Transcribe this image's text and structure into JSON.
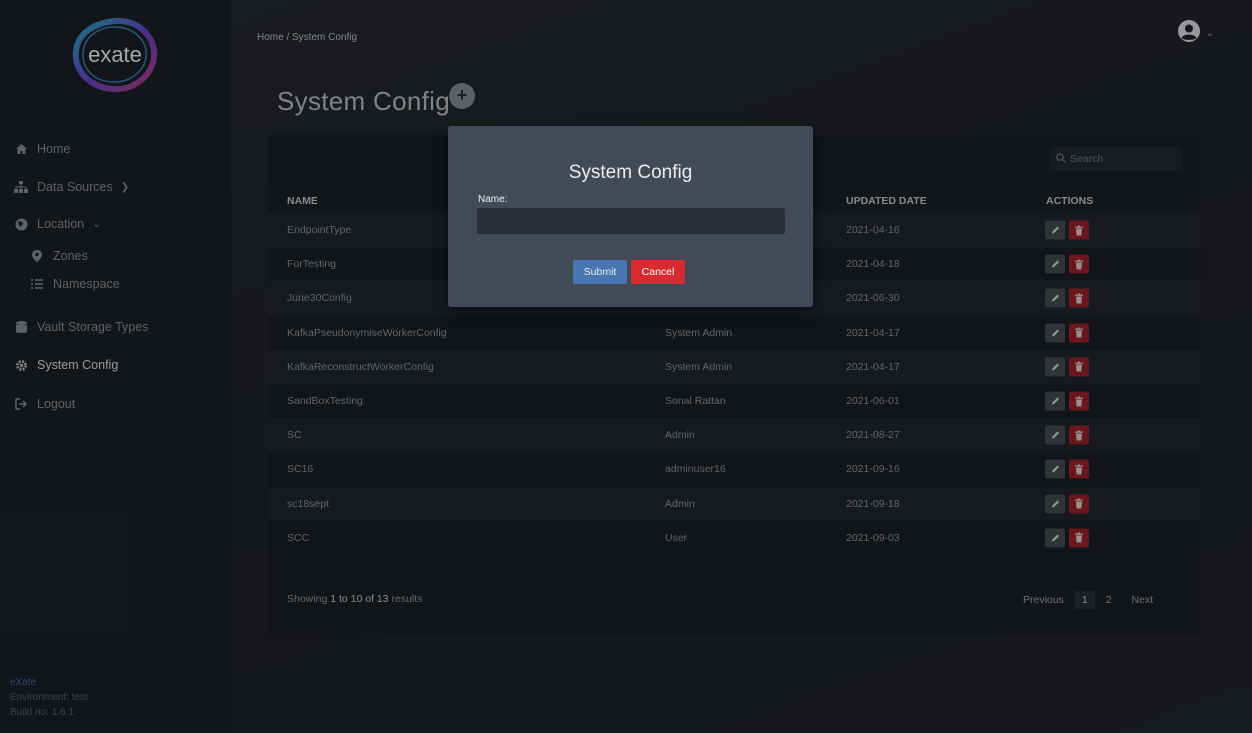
{
  "app": {
    "logo_text": "exate"
  },
  "sidebar": {
    "items": [
      {
        "label": "Home",
        "icon": "home-icon"
      },
      {
        "label": "Data Sources",
        "icon": "sitemap-icon"
      },
      {
        "label": "Location",
        "icon": "globe-icon"
      },
      {
        "label": "Zones",
        "icon": "map-pin-icon"
      },
      {
        "label": "Namespace",
        "icon": "list-icon"
      },
      {
        "label": "Vault Storage Types",
        "icon": "database-icon"
      },
      {
        "label": "System Config",
        "icon": "gear-icon"
      },
      {
        "label": "Logout",
        "icon": "logout-icon"
      }
    ],
    "footer": {
      "brand": "eXate",
      "environment": "Environment: test",
      "build": "Build no: 1.6.1"
    }
  },
  "header": {
    "breadcrumb": "Home /  System Config"
  },
  "page": {
    "title": "System Config",
    "add_label": "+"
  },
  "table": {
    "search_placeholder": "Search",
    "columns": [
      "NAME",
      "UPDATED DATE",
      "ACTIONS"
    ],
    "rows": [
      {
        "name": "EndpointType",
        "user": "",
        "date": "2021-04-16"
      },
      {
        "name": "ForTesting",
        "user": "",
        "date": "2021-04-18"
      },
      {
        "name": "June30Config",
        "user": "",
        "date": "2021-06-30"
      },
      {
        "name": "KafkaPseudonymiseWorkerConfig",
        "user": "System Admin",
        "date": "2021-04-17"
      },
      {
        "name": "KafkaReconstructWorkerConfig",
        "user": "System Admin",
        "date": "2021-04-17"
      },
      {
        "name": "SandBoxTesting",
        "user": "Sonal Rattan",
        "date": "2021-06-01"
      },
      {
        "name": "SC",
        "user": "Admin",
        "date": "2021-08-27"
      },
      {
        "name": "SC16",
        "user": "adminuser16",
        "date": "2021-09-16"
      },
      {
        "name": "sc18sept",
        "user": "Admin",
        "date": "2021-09-18"
      },
      {
        "name": "SCC",
        "user": "User",
        "date": "2021-09-03"
      }
    ],
    "showing": {
      "prefix": "Showing ",
      "range": "1 to 10 of 13",
      "suffix": " results"
    },
    "pagination": {
      "previous": "Previous",
      "pages": [
        "1",
        "2"
      ],
      "next": "Next"
    }
  },
  "modal": {
    "title": "System Config",
    "name_label": "Name:",
    "name_value": "",
    "submit_label": "Submit",
    "cancel_label": "Cancel"
  },
  "colors": {
    "accent_blue": "#4876b0",
    "danger_red": "#d52b31",
    "sidebar_bg": "#1d2228"
  }
}
